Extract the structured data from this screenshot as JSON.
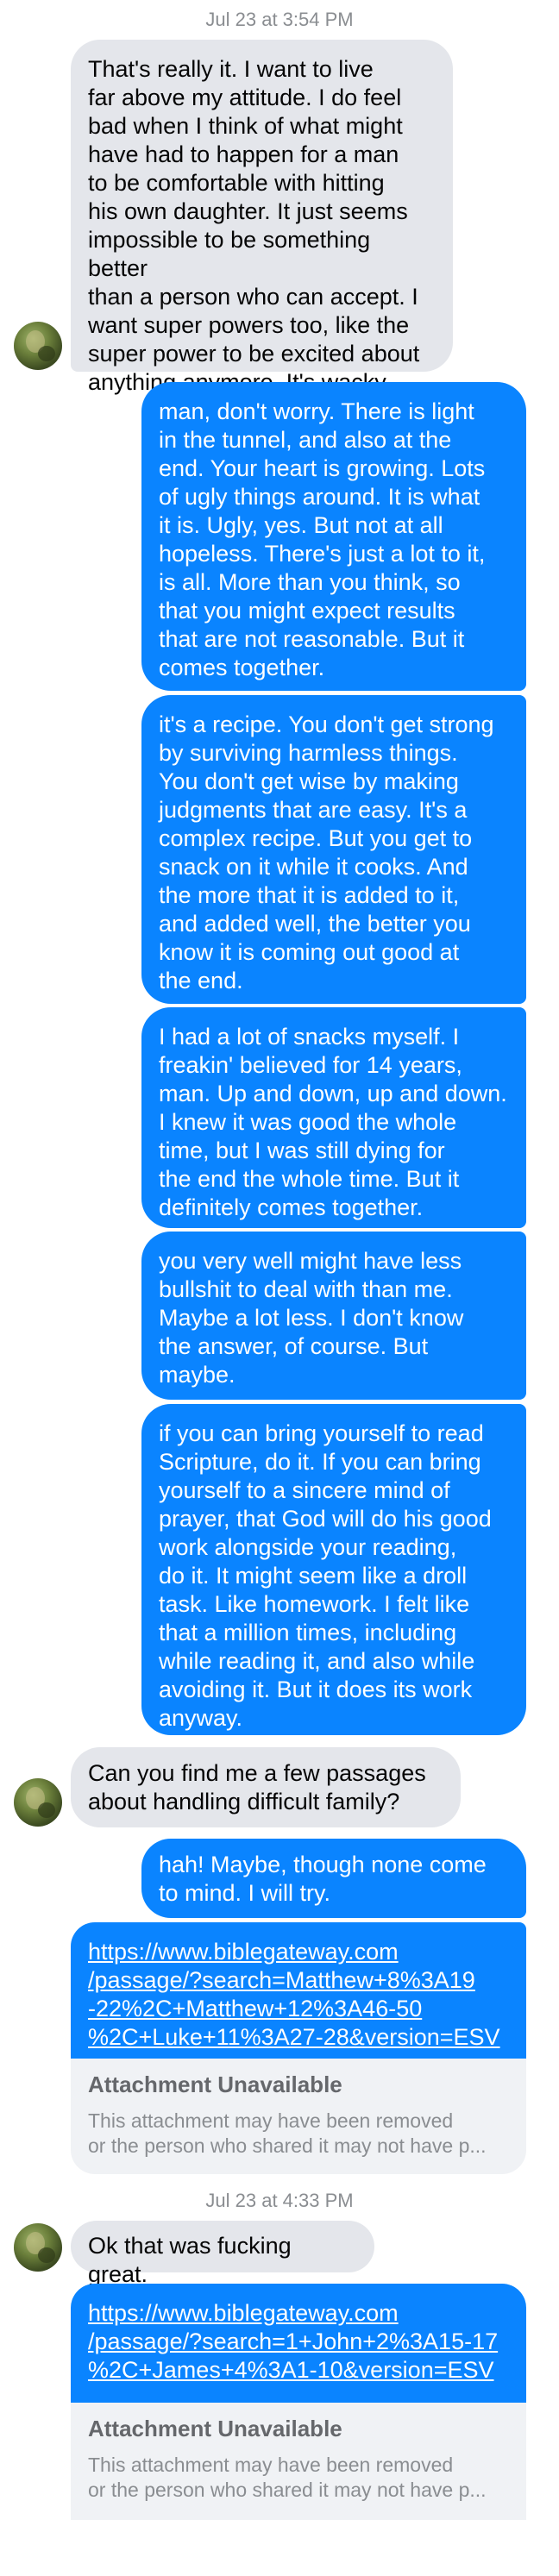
{
  "timestamps": [
    "Jul 23 at 3:54 PM",
    "Jul 23 at 4:33 PM"
  ],
  "messages": {
    "m1": "That's really it. I want to live\nfar above my attitude. I do feel\nbad when I think of what might\nhave had to happen for a man\nto be comfortable with hitting\nhis own daughter. It just seems\nimpossible to be something better\nthan a person who can accept. I\nwant super powers too, like the\nsuper power to be excited about\nanything anymore. It's wacky.",
    "m2": "man, don't worry. There is light\nin the tunnel, and also at the\nend. Your heart is growing. Lots\nof ugly things around. It is what\nit is. Ugly, yes. But not at all\nhopeless. There's just a lot to it,\nis all. More than you think, so\nthat you might expect results\nthat are not reasonable. But it\ncomes together.",
    "m3": "it's a recipe. You don't get strong\nby surviving harmless things.\nYou don't get wise by making\njudgments that are easy. It's a\ncomplex recipe. But you get to\nsnack on it while it cooks. And\nthe more that it is added to it,\nand added well, the better you\nknow it is coming out good at\nthe end.",
    "m4": "I had a lot of snacks myself. I\nfreakin' believed for 14 years,\nman. Up and down, up and down.\nI knew it was good the whole\ntime, but I was still dying for\nthe end the whole time. But it\ndefinitely comes together.",
    "m5": "you very well might have less\nbullshit to deal with than me.\nMaybe a lot less. I don't know\nthe answer, of course. But\nmaybe.",
    "m6": "if you can bring yourself to read\nScripture, do it. If you can bring\nyourself to a sincere mind of\nprayer, that God will do his good\nwork alongside your reading,\ndo it. It might seem like a droll\ntask. Like homework. I felt like\nthat a million times, including\nwhile reading it, and also while\navoiding it. But it does its work\nanyway.",
    "m7": "Can you find me a few passages\nabout handling difficult family?",
    "m8": "hah! Maybe, though none come\nto mind. I will try.",
    "m9": "Ok that was fucking great."
  },
  "links": {
    "link1": "https://www.biblegateway.com\n/passage/?search=Matthew+8%3A19\n-22%2C+Matthew+12%3A46-50\n%2C+Luke+11%3A27-28&version=ESV",
    "link2": "https://www.biblegateway.com\n/passage/?search=1+John+2%3A15-17\n%2C+James+4%3A1-10&version=ESV"
  },
  "attachment": {
    "title": "Attachment Unavailable",
    "line1": "This attachment may have been removed",
    "line2": "or the person who shared it may not have p..."
  },
  "colors": {
    "outgoing_bubble": "#0a84ff",
    "incoming_bubble": "#e4e6eb",
    "attachment_bg": "#f0f2f5",
    "timestamp_text": "#8a8d91"
  }
}
